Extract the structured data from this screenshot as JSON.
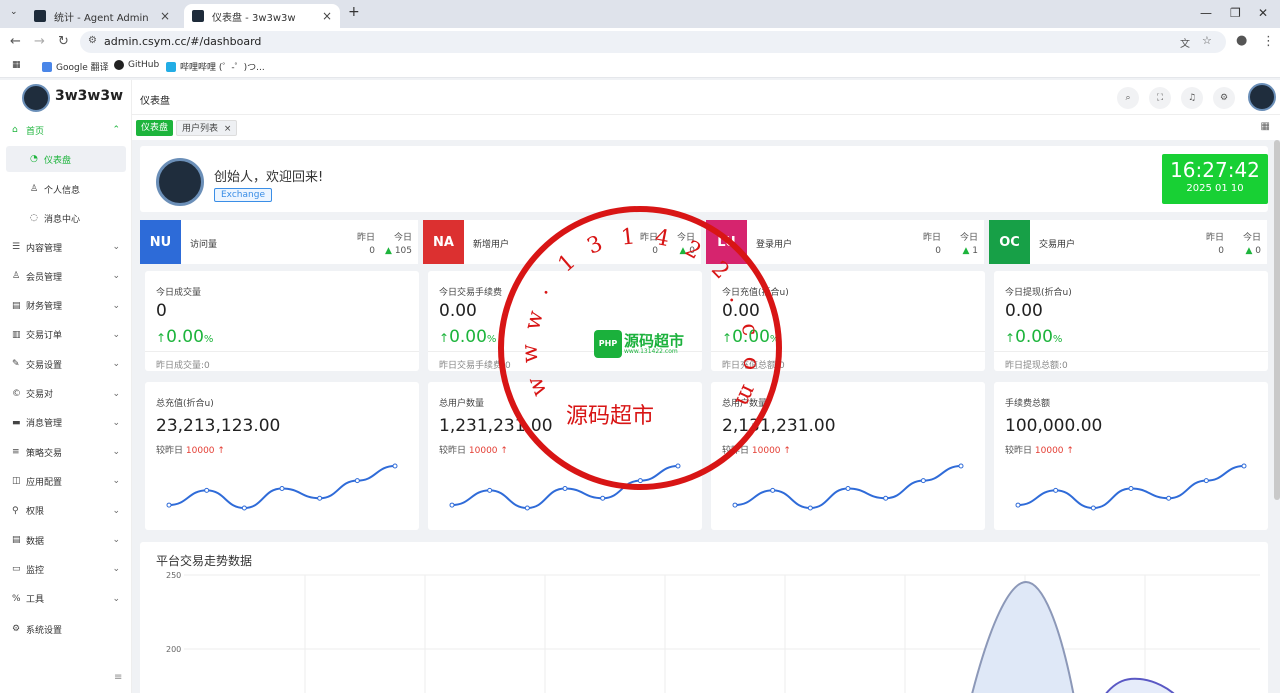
{
  "browser": {
    "tabs": [
      {
        "title": "统计 - Agent Admin"
      },
      {
        "title": "仪表盘 - 3w3w3w"
      }
    ],
    "new_tab": "+",
    "url": "admin.csym.cc/#/dashboard",
    "bookmarks": [
      {
        "label": "Google 翻译"
      },
      {
        "label": "GitHub"
      },
      {
        "label": "哔哩哔哩 (゜-゜)つ..."
      }
    ]
  },
  "app": {
    "brand": "3w3w3w",
    "breadcrumb": "仪表盘",
    "sidebar": {
      "home": "首页",
      "dashboard": "仪表盘",
      "profile": "个人信息",
      "messages": "消息中心",
      "items": [
        {
          "label": "内容管理",
          "icon": "list-icon"
        },
        {
          "label": "会员管理",
          "icon": "user-icon"
        },
        {
          "label": "财务管理",
          "icon": "wallet-icon"
        },
        {
          "label": "交易订单",
          "icon": "order-icon"
        },
        {
          "label": "交易设置",
          "icon": "wrench-icon"
        },
        {
          "label": "交易对",
          "icon": "coin-icon"
        },
        {
          "label": "消息管理",
          "icon": "message-icon"
        },
        {
          "label": "策略交易",
          "icon": "strategy-icon"
        },
        {
          "label": "应用配置",
          "icon": "app-icon"
        },
        {
          "label": "权限",
          "icon": "permission-icon"
        },
        {
          "label": "数据",
          "icon": "data-icon"
        },
        {
          "label": "监控",
          "icon": "monitor-icon"
        },
        {
          "label": "工具",
          "icon": "tool-icon"
        }
      ],
      "settings": "系统设置"
    },
    "tags": {
      "active": "仪表盘",
      "other": "用户列表",
      "close": "×"
    }
  },
  "welcome": {
    "greeting": "创始人，欢迎回来!",
    "tag": "Exchange",
    "time": "16:27:42",
    "date": "2025 01 10"
  },
  "stats": [
    {
      "badge": "NU",
      "color": "#2d6bd8",
      "label": "访问量",
      "yesterday_label": "昨日",
      "yesterday": "0",
      "today_label": "今日",
      "today": "105"
    },
    {
      "badge": "NA",
      "color": "#dc3030",
      "label": "新增用户",
      "yesterday_label": "昨日",
      "yesterday": "0",
      "today_label": "今日",
      "today": "0"
    },
    {
      "badge": "LU",
      "color": "#d6246e",
      "label": "登录用户",
      "yesterday_label": "昨日",
      "yesterday": "0",
      "today_label": "今日",
      "today": "1"
    },
    {
      "badge": "OC",
      "color": "#17a047",
      "label": "交易用户",
      "yesterday_label": "昨日",
      "yesterday": "0",
      "today_label": "今日",
      "today": "0"
    }
  ],
  "metrics": [
    {
      "title": "今日成交量",
      "value": "0",
      "pct": "0.00",
      "unit": "%",
      "arrow": "↑",
      "foot": "昨日成交量:0"
    },
    {
      "title": "今日交易手续费",
      "value": "0.00",
      "pct": "0.00",
      "unit": "%",
      "arrow": "↑",
      "foot": "昨日交易手续费:0"
    },
    {
      "title": "今日充值(折合u)",
      "value": "0.00",
      "pct": "0.00",
      "unit": "%",
      "arrow": "↑",
      "foot": "昨日充值总额:0"
    },
    {
      "title": "今日提现(折合u)",
      "value": "0.00",
      "pct": "0.00",
      "unit": "%",
      "arrow": "↑",
      "foot": "昨日提现总额:0"
    }
  ],
  "totals": [
    {
      "title": "总充值(折合u)",
      "value": "23,213,123.00",
      "cmp_label": "较昨日",
      "cmp_value": "10000",
      "arrow": "↑"
    },
    {
      "title": "总用户数量",
      "value": "1,231,231.00",
      "cmp_label": "较昨日",
      "cmp_value": "10000",
      "arrow": "↑"
    },
    {
      "title": "总用户数量",
      "value": "2,131,231.00",
      "cmp_label": "较昨日",
      "cmp_value": "10000",
      "arrow": "↑"
    },
    {
      "title": "手续费总额",
      "value": "100,000.00",
      "cmp_label": "较昨日",
      "cmp_value": "10000",
      "arrow": "↑"
    }
  ],
  "trend": {
    "title": "平台交易走势数据",
    "yticks": [
      "250",
      "200"
    ]
  },
  "watermark": {
    "stamp_text": "源码超市",
    "stamp_chars": [
      "w",
      "w",
      "w",
      ".",
      "1",
      "3",
      "1",
      "4",
      "2",
      "2",
      ".",
      "c",
      "o",
      "m"
    ],
    "logo_badge": "PHP",
    "logo_text": "源码超市",
    "logo_sub": "www.131422.com"
  },
  "chart_data": {
    "type": "line",
    "sparkline_values": [
      5,
      20,
      2,
      22,
      12,
      30,
      45
    ]
  }
}
